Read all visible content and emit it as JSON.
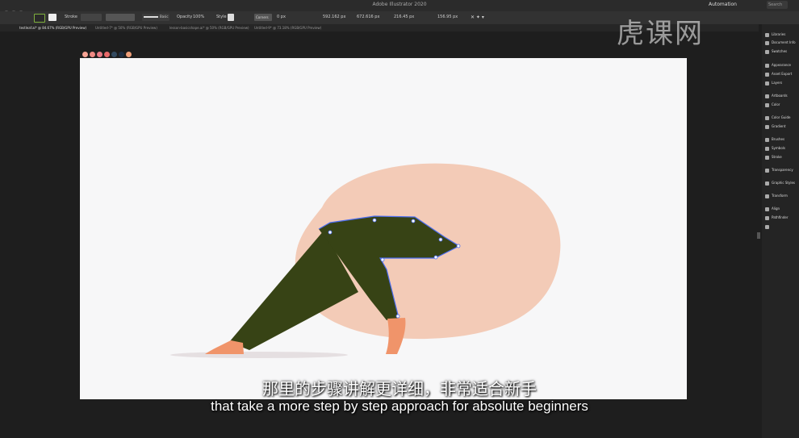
{
  "window": {
    "title": "Adobe Illustrator 2020",
    "workspace": "Automation",
    "search_placeholder": "Search"
  },
  "control_bar": {
    "stroke_label": "Stroke",
    "brush_label": "Basic",
    "opacity_label": "Opacity",
    "opacity_value": "100%",
    "style_label": "Style",
    "corners_label": "Corners",
    "corners_value": "0 px",
    "x_value": "592.162 px",
    "y_value": "672.616 px",
    "w_value": "216.45 px",
    "h_value": "156.95 px"
  },
  "tabs": [
    "testleaf.ai* @ 84.67% (RGB/GPU Preview)",
    "Untitled-7* @ 50% (RGB/GPU Preview)",
    "lesson-basicshape.ai* @ 50% (RGB/GPU Preview)",
    "Untitled-9* @ 73.18% (RGB/GPU Preview)"
  ],
  "right_panel": {
    "items": [
      "Libraries",
      "Document Info",
      "Swatches",
      "Appearance",
      "Asset Export",
      "Layers",
      "Artboards",
      "Color",
      "Color Guide",
      "Gradient",
      "Brushes",
      "Symbols",
      "Stroke",
      "Transparency",
      "Graphic Styles",
      "Transform",
      "Align",
      "Pathfinder"
    ]
  },
  "swatches": [
    "#f6a394",
    "#f08a84",
    "#ea7b86",
    "#e86a6a",
    "#334a60",
    "#1f2f44",
    "#f0a07a"
  ],
  "colors": {
    "blob": "#f3cbb7",
    "pants": "#374315",
    "skin": "#f0946a",
    "shadow": "#e5dfe1",
    "selection": "#4a6cf0"
  },
  "watermark": {
    "logo": "虎课网"
  },
  "subtitles": {
    "cn": "那里的步骤讲解更详细，非常适合新手",
    "en": "that take a more step by step approach for absolute beginners"
  }
}
